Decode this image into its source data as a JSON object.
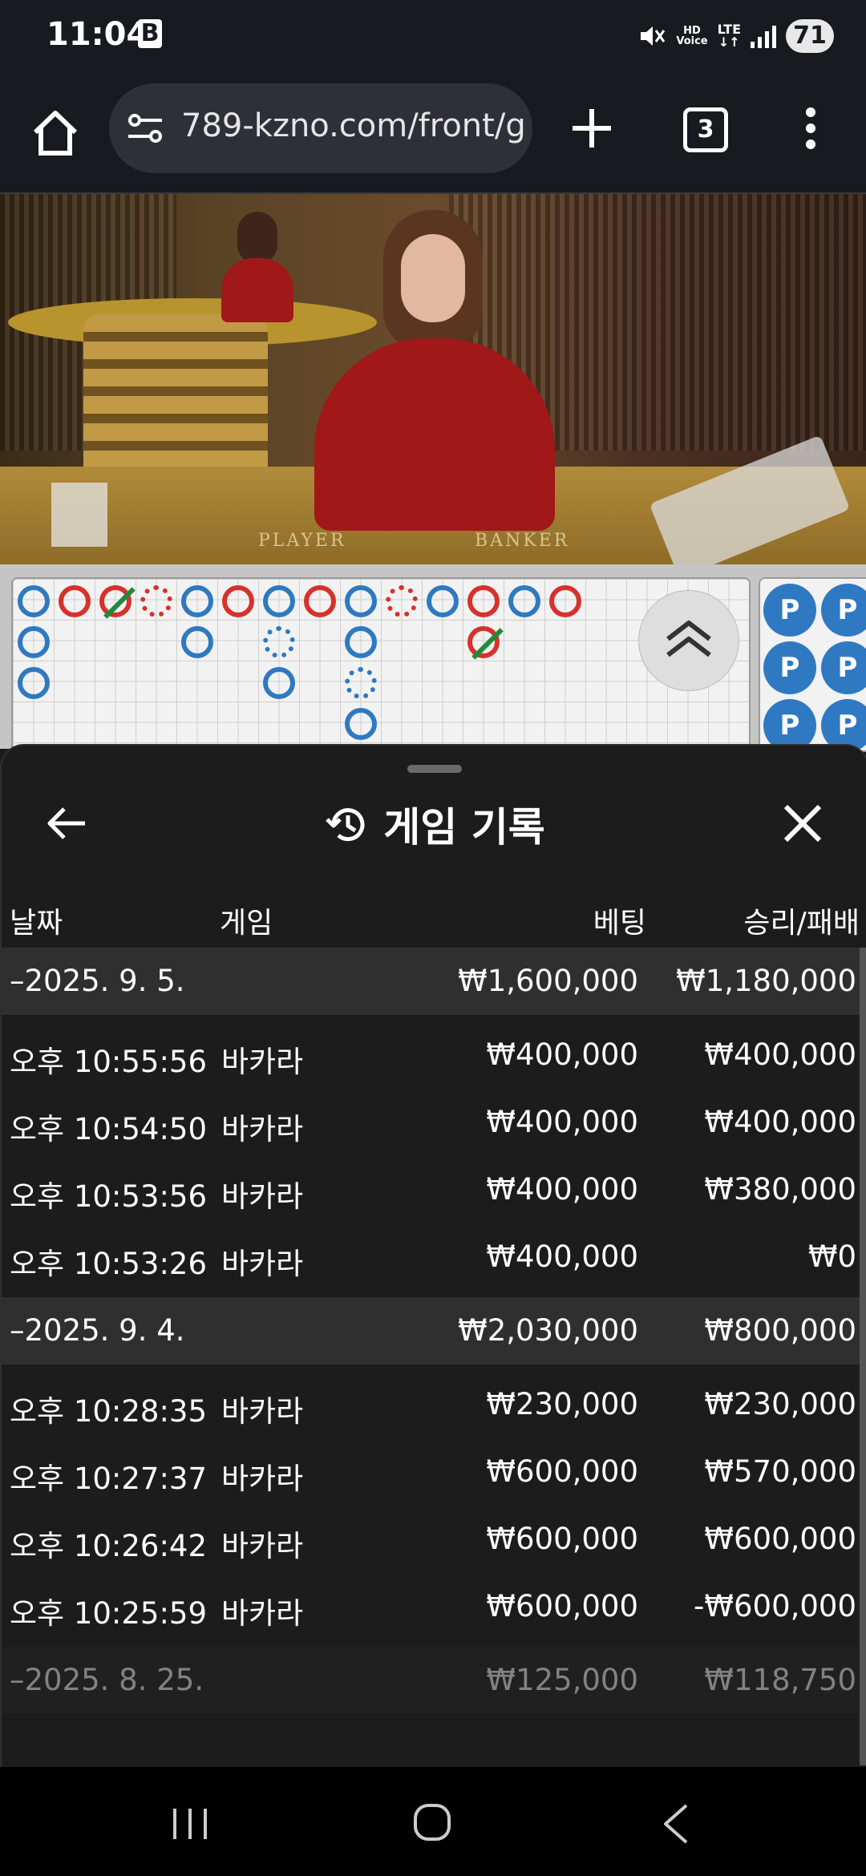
{
  "status_bar": {
    "time": "11:04",
    "app_badge": "B",
    "hd_voice": "HD\nVoice",
    "network": "LTE",
    "battery": "71"
  },
  "browser": {
    "url": "789-kzno.com/front/g",
    "tab_count": "3"
  },
  "video": {
    "table_left": "PLAYER",
    "table_right": "BANKER"
  },
  "roadmap": {
    "bead_plate_label": "P"
  },
  "sheet": {
    "title": "게임 기록",
    "columns": {
      "date": "날짜",
      "game": "게임",
      "bet": "베팅",
      "result": "승리/패배"
    },
    "groups": [
      {
        "date": "–2025. 9. 5.",
        "bet": "₩1,600,000",
        "result": "₩1,180,000",
        "rows": [
          {
            "time": "오후 10:55:56",
            "game": "바카라",
            "bet": "₩400,000",
            "result": "₩400,000"
          },
          {
            "time": "오후 10:54:50",
            "game": "바카라",
            "bet": "₩400,000",
            "result": "₩400,000"
          },
          {
            "time": "오후 10:53:56",
            "game": "바카라",
            "bet": "₩400,000",
            "result": "₩380,000"
          },
          {
            "time": "오후 10:53:26",
            "game": "바카라",
            "bet": "₩400,000",
            "result": "₩0"
          }
        ]
      },
      {
        "date": "–2025. 9. 4.",
        "bet": "₩2,030,000",
        "result": "₩800,000",
        "rows": [
          {
            "time": "오후 10:28:35",
            "game": "바카라",
            "bet": "₩230,000",
            "result": "₩230,000"
          },
          {
            "time": "오후 10:27:37",
            "game": "바카라",
            "bet": "₩600,000",
            "result": "₩570,000"
          },
          {
            "time": "오후 10:26:42",
            "game": "바카라",
            "bet": "₩600,000",
            "result": "₩600,000"
          },
          {
            "time": "오후 10:25:59",
            "game": "바카라",
            "bet": "₩600,000",
            "result": "-₩600,000"
          }
        ]
      },
      {
        "date": "–2025. 8. 25.",
        "bet": "₩125,000",
        "result": "₩118,750",
        "rows": []
      }
    ]
  },
  "colors": {
    "player_blue": "#2f79c2",
    "banker_red": "#d6322c",
    "tie_green": "#1f8a3c",
    "sheet_bg": "#1c1c1c",
    "group_bg": "#2f2f2f"
  },
  "icons": {
    "home": "home-icon",
    "url_tune": "tune-icon",
    "new_tab": "plus-icon",
    "menu": "more-vert-icon",
    "back": "arrow-left-icon",
    "history": "history-icon",
    "close": "close-icon",
    "scroll_up": "chevron-double-up-icon"
  }
}
